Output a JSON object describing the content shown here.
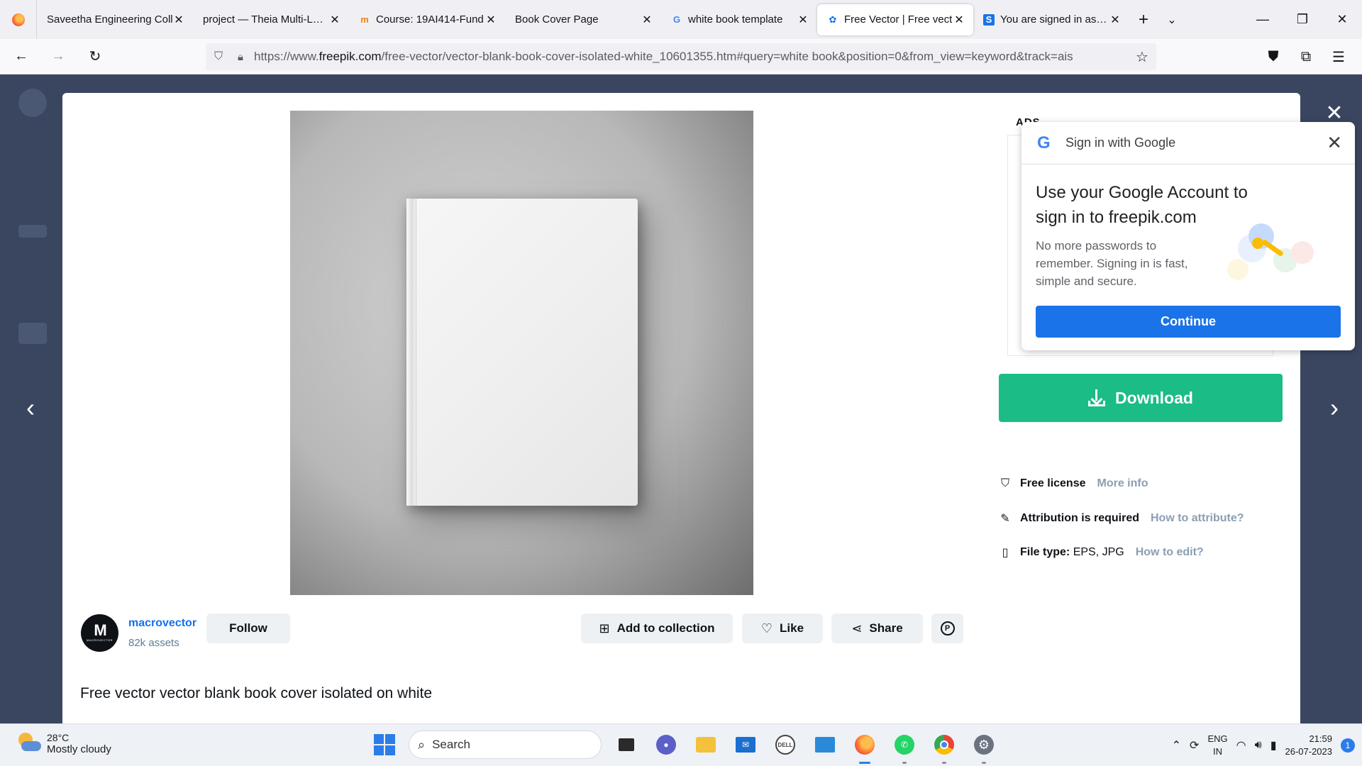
{
  "browser": {
    "tabs": [
      {
        "title": "Saveetha Engineering Coll",
        "icon": "globe-icon",
        "active": false
      },
      {
        "title": "project — Theia Multi-Lang",
        "icon": "theia-icon",
        "active": false
      },
      {
        "title": "Course: 19AI414-Fund",
        "icon": "moodle-icon",
        "active": false
      },
      {
        "title": "Book Cover Page",
        "icon": "",
        "active": false
      },
      {
        "title": "white book template",
        "icon": "google-icon",
        "active": false
      },
      {
        "title": "Free Vector | Free vect",
        "icon": "freepik-icon",
        "active": true
      },
      {
        "title": "You are signed in as ex",
        "icon": "s-icon",
        "active": false
      }
    ],
    "url_prefix": "https://www.",
    "url_domain": "freepik.com",
    "url_path": "/free-vector/vector-blank-book-cover-isolated-white_10601355.htm#query=white book&position=0&from_view=keyword&track=ais"
  },
  "author": {
    "name": "macrovector",
    "assets": "82k assets",
    "avatar_text": "M",
    "avatar_small": "MACROVECTOR",
    "follow_label": "Follow"
  },
  "actions": {
    "collection": "Add to collection",
    "like": "Like",
    "share": "Share"
  },
  "asset": {
    "title": "Free vector vector blank book cover isolated on white"
  },
  "sidebar": {
    "label": "ADS",
    "download": "Download",
    "license_label": "Free license",
    "license_link": "More info",
    "attribution_label": "Attribution is required",
    "attribution_link": "How to attribute?",
    "filetype_label": "File type:",
    "filetype_value": "EPS, JPG",
    "filetype_link": "How to edit?"
  },
  "google_popup": {
    "header": "Sign in with Google",
    "heading": "Use your Google Account to sign in to freepik.com",
    "description": "No more passwords to remember. Signing in is fast, simple and secure.",
    "continue": "Continue"
  },
  "taskbar": {
    "temperature": "28°C",
    "condition": "Mostly cloudy",
    "search_placeholder": "Search",
    "lang_1": "ENG",
    "lang_2": "IN",
    "time": "21:59",
    "date": "26-07-2023",
    "notifications": "1"
  },
  "colors": {
    "download": "#1bbc85",
    "google_continue": "#1a73e8",
    "link_blue": "#1273eb"
  }
}
